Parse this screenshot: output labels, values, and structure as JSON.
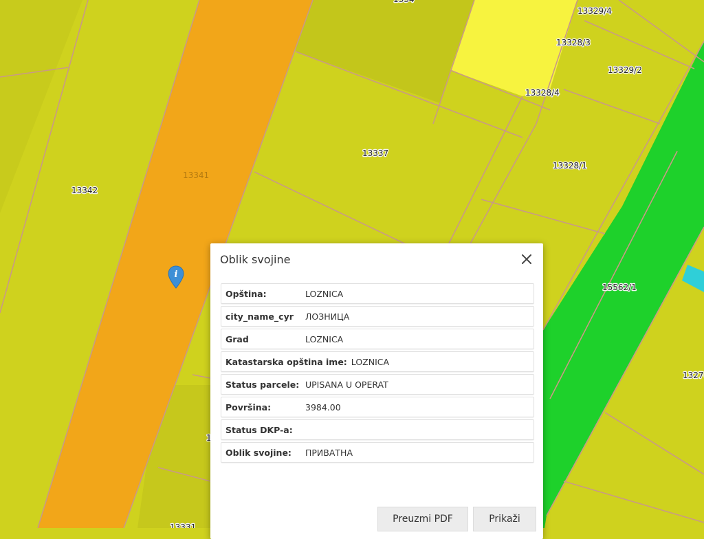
{
  "map": {
    "parcel_labels": [
      "13342",
      "13341",
      "13337",
      "13329/4",
      "13328/3",
      "13329/2",
      "13328/4",
      "13328/1",
      "15562/1",
      "1327(",
      "13331",
      "1",
      "1334"
    ],
    "colors": {
      "parcel_yellow": "#cfd21e",
      "parcel_bright_yellow": "#f7f33f",
      "parcel_orange": "#f2a619",
      "parcel_green": "#1ed12b",
      "parcel_cyan": "#2fcfd8",
      "boundary": "#c99a86"
    },
    "info_marker_icon": "info-pin-icon"
  },
  "dialog": {
    "title": "Oblik svojine",
    "close_icon": "close-icon",
    "rows": [
      {
        "label": "Opština:",
        "value": "LOZNICA"
      },
      {
        "label": "city_name_cyr",
        "value": "ЛОЗНИЦА"
      },
      {
        "label": "Grad",
        "value": "LOZNICA"
      },
      {
        "label": "Katastarska opština ime:",
        "value": "LOZNICA"
      },
      {
        "label": "Status parcele:",
        "value": "UPISANA U OPERAT"
      },
      {
        "label": "Površina:",
        "value": "3984.00"
      },
      {
        "label": "Status DKP-a:",
        "value": ""
      },
      {
        "label": "Oblik svojine:",
        "value": "ПРИВАТНА"
      }
    ],
    "buttons": {
      "pdf": "Preuzmi PDF",
      "show": "Prikaži"
    }
  }
}
